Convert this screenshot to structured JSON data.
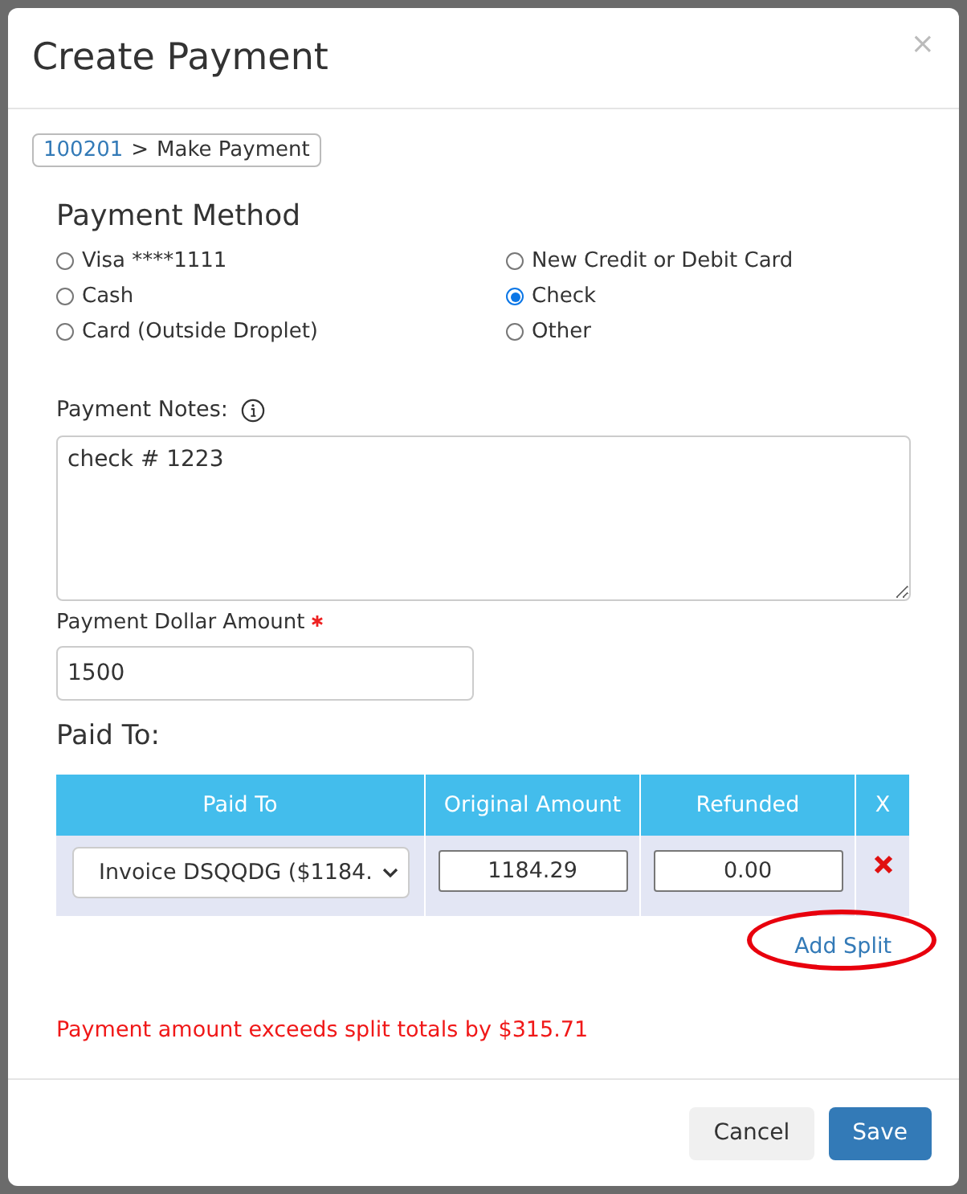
{
  "dialog": {
    "title": "Create Payment",
    "close": "×"
  },
  "breadcrumb": {
    "link": "100201",
    "separator": ">",
    "current": "Make Payment"
  },
  "payment_method": {
    "heading": "Payment Method",
    "options": [
      {
        "label": "Visa ****1111",
        "selected": false
      },
      {
        "label": "New Credit or Debit Card",
        "selected": false
      },
      {
        "label": "Cash",
        "selected": false
      },
      {
        "label": "Check",
        "selected": true
      },
      {
        "label": "Card (Outside Droplet)",
        "selected": false
      },
      {
        "label": "Other",
        "selected": false
      }
    ]
  },
  "notes": {
    "label": "Payment Notes:",
    "value": "check # 1223"
  },
  "amount": {
    "label": "Payment Dollar Amount",
    "required": true,
    "value": "1500"
  },
  "paid_to": {
    "heading": "Paid To:",
    "columns": [
      "Paid To",
      "Original Amount",
      "Refunded",
      "X"
    ],
    "rows": [
      {
        "invoice": "Invoice DSQQDG ($1184.",
        "original_amount": "1184.29",
        "refunded": "0.00"
      }
    ],
    "add_split": "Add Split"
  },
  "error": "Payment amount exceeds split totals by $315.71",
  "buttons": {
    "cancel": "Cancel",
    "save": "Save"
  }
}
